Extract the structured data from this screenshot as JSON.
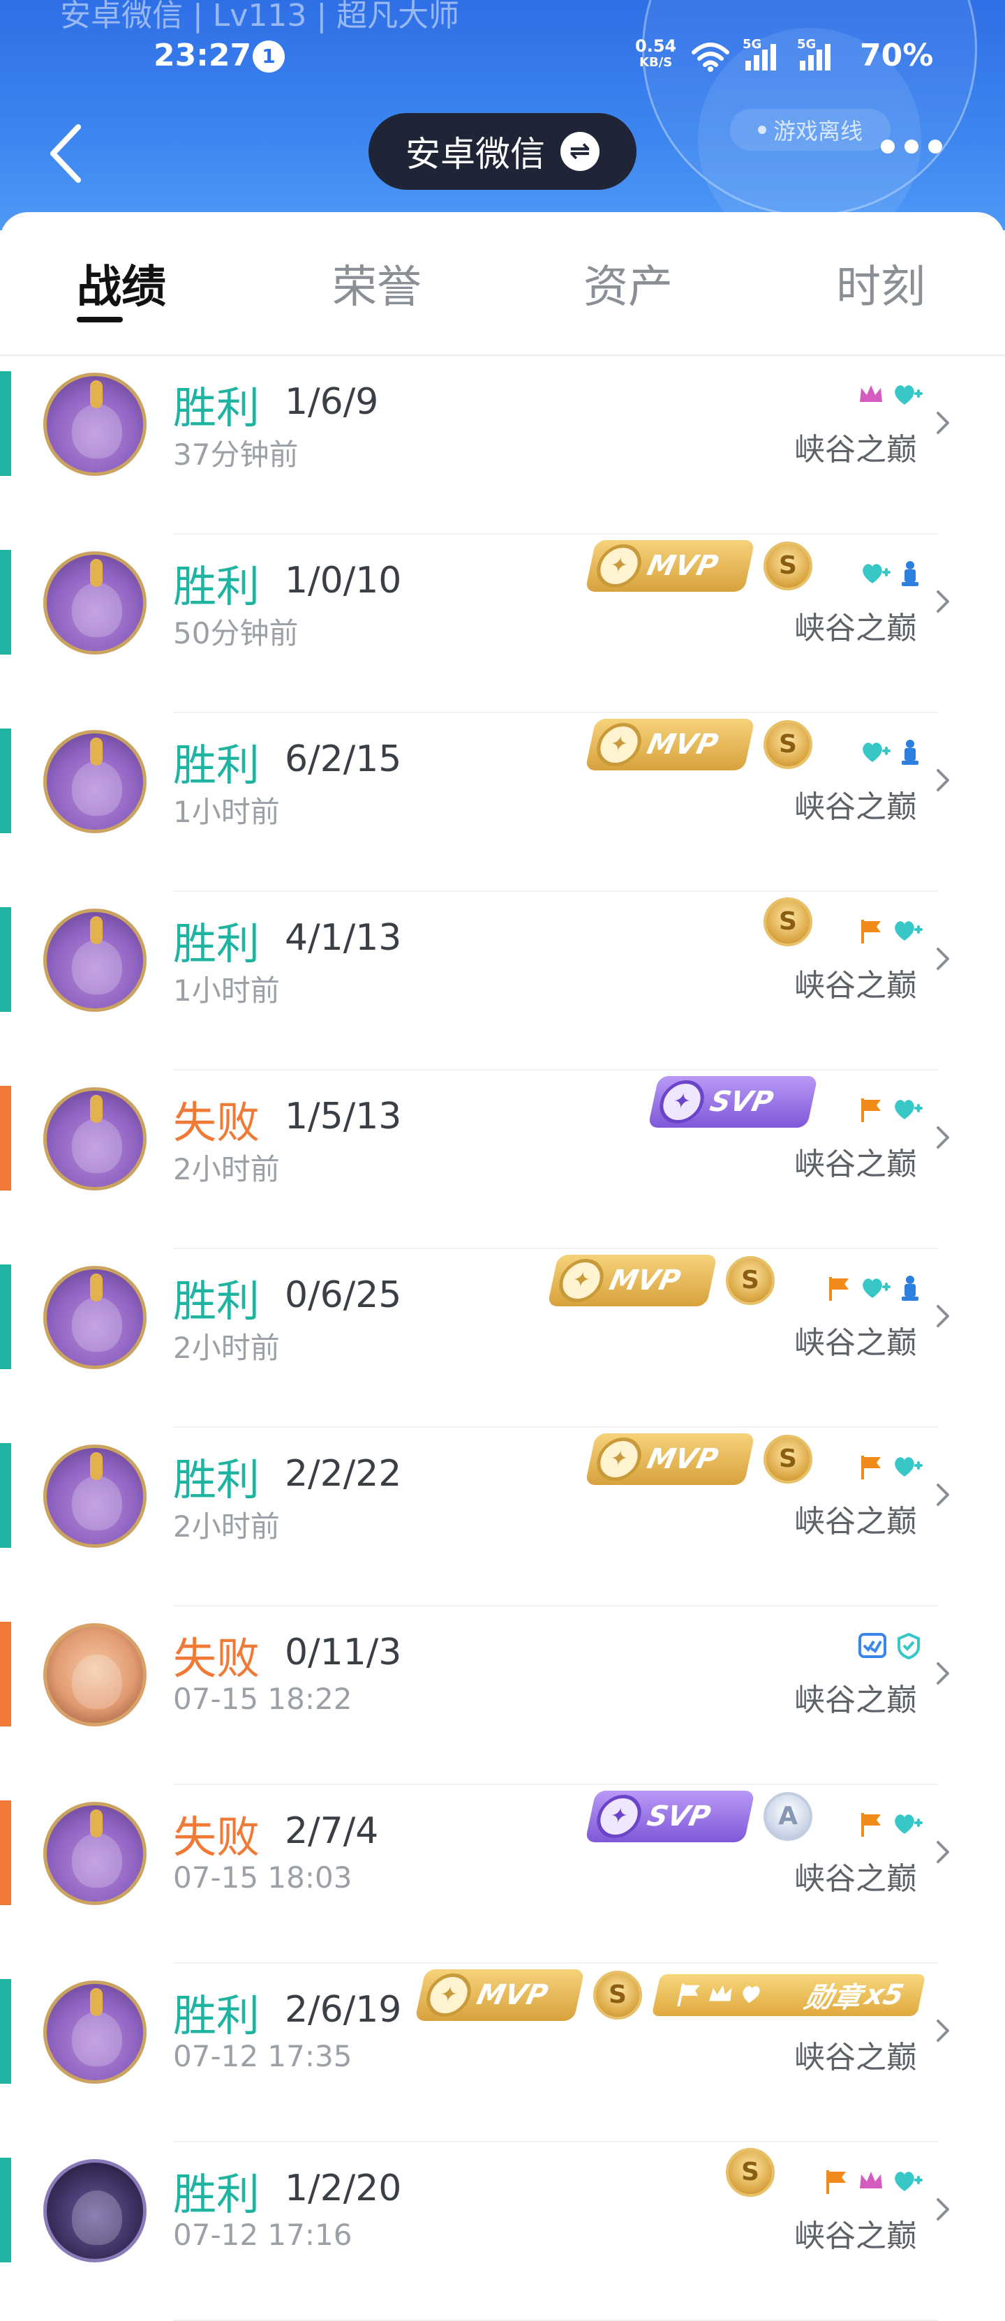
{
  "header": {
    "faded_title": "安卓微信 | Lv113 | 超凡大师",
    "status_bar": {
      "time": "23:27",
      "notification_count": "1",
      "net_speed_value": "0.54",
      "net_speed_unit": "KB/S",
      "signal_1_label": "5G",
      "signal_2_label": "5G",
      "battery": "70%"
    },
    "account_switch_label": "安卓微信",
    "account_switch_icon": "swap-icon",
    "game_status": "游戏离线"
  },
  "tabs": [
    {
      "label": "战绩",
      "active": true
    },
    {
      "label": "荣誉",
      "active": false
    },
    {
      "label": "资产",
      "active": false
    },
    {
      "label": "时刻",
      "active": false
    }
  ],
  "records": [
    {
      "result": "胜利",
      "outcome": "win",
      "kda": "1/6/9",
      "time": "37分钟前",
      "mode": "峡谷之巅",
      "avatar": "purple",
      "mvp": "",
      "rank": "",
      "medal": "",
      "icons": [
        "crown-icon",
        "heart-plus-icon"
      ]
    },
    {
      "result": "胜利",
      "outcome": "win",
      "kda": "1/0/10",
      "time": "50分钟前",
      "mode": "峡谷之巅",
      "avatar": "purple",
      "mvp": "MVP",
      "mvp_type": "gold",
      "rank": "S",
      "medal": "",
      "icons": [
        "heart-plus-icon",
        "chess-icon"
      ]
    },
    {
      "result": "胜利",
      "outcome": "win",
      "kda": "6/2/15",
      "time": "1小时前",
      "mode": "峡谷之巅",
      "avatar": "purple",
      "mvp": "MVP",
      "mvp_type": "gold",
      "rank": "S",
      "medal": "",
      "icons": [
        "heart-plus-icon",
        "chess-icon"
      ]
    },
    {
      "result": "胜利",
      "outcome": "win",
      "kda": "4/1/13",
      "time": "1小时前",
      "mode": "峡谷之巅",
      "avatar": "purple",
      "mvp": "",
      "rank": "S",
      "medal": "",
      "icons": [
        "flag-icon",
        "heart-plus-icon"
      ]
    },
    {
      "result": "失败",
      "outcome": "loss",
      "kda": "1/5/13",
      "time": "2小时前",
      "mode": "峡谷之巅",
      "avatar": "purple",
      "mvp": "SVP",
      "mvp_type": "silver",
      "rank": "",
      "medal": "",
      "icons": [
        "flag-icon",
        "heart-plus-icon"
      ]
    },
    {
      "result": "胜利",
      "outcome": "win",
      "kda": "0/6/25",
      "time": "2小时前",
      "mode": "峡谷之巅",
      "avatar": "purple",
      "mvp": "MVP",
      "mvp_type": "gold",
      "rank": "S",
      "medal": "",
      "icons": [
        "flag-icon",
        "heart-plus-icon",
        "chess-icon"
      ]
    },
    {
      "result": "胜利",
      "outcome": "win",
      "kda": "2/2/22",
      "time": "2小时前",
      "mode": "峡谷之巅",
      "avatar": "purple",
      "mvp": "MVP",
      "mvp_type": "gold",
      "rank": "S",
      "medal": "",
      "icons": [
        "flag-icon",
        "heart-plus-icon"
      ]
    },
    {
      "result": "失败",
      "outcome": "loss",
      "kda": "0/11/3",
      "time": "07-15 18:22",
      "mode": "峡谷之巅",
      "avatar": "human",
      "mvp": "",
      "rank": "",
      "medal": "",
      "icons": [
        "check-double-icon",
        "shield-icon"
      ]
    },
    {
      "result": "失败",
      "outcome": "loss",
      "kda": "2/7/4",
      "time": "07-15 18:03",
      "mode": "峡谷之巅",
      "avatar": "purple",
      "mvp": "SVP",
      "mvp_type": "silver",
      "rank": "A",
      "rank_type": "silver",
      "medal": "",
      "icons": [
        "flag-icon",
        "heart-plus-icon"
      ]
    },
    {
      "result": "胜利",
      "outcome": "win",
      "kda": "2/6/19",
      "time": "07-12 17:35",
      "mode": "峡谷之巅",
      "avatar": "purple",
      "mvp": "MVP",
      "mvp_type": "gold",
      "rank": "S",
      "medal": "勋章",
      "medal_count": "x5",
      "icons": []
    },
    {
      "result": "胜利",
      "outcome": "win",
      "kda": "1/2/20",
      "time": "07-12 17:16",
      "mode": "峡谷之巅",
      "avatar": "dark",
      "mvp": "",
      "rank": "S",
      "medal": "",
      "icons": [
        "flag-icon",
        "crown-icon",
        "heart-plus-icon"
      ]
    }
  ],
  "colors": {
    "header_blue": "#2f6fe6",
    "win_teal": "#1fb3a1",
    "loss_orange": "#f07a35",
    "mvp_gold": "#d8a23d",
    "svp_purple": "#7e58d8"
  }
}
